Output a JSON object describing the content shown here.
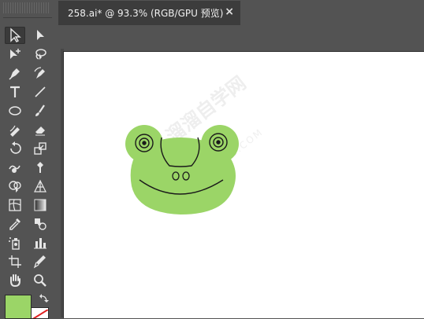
{
  "document_tab": {
    "title": "258.ai* @ 93.3% (RGB/GPU 预览)",
    "close_symbol": "×"
  },
  "tools": [
    {
      "name": "selection-tool-icon",
      "active": true
    },
    {
      "name": "direct-selection-tool-icon"
    },
    {
      "name": "magic-wand-tool-icon"
    },
    {
      "name": "lasso-tool-icon"
    },
    {
      "name": "pen-tool-icon"
    },
    {
      "name": "curvature-tool-icon"
    },
    {
      "name": "type-tool-icon",
      "glyph": "T"
    },
    {
      "name": "line-segment-tool-icon"
    },
    {
      "name": "ellipse-tool-icon"
    },
    {
      "name": "paintbrush-tool-icon"
    },
    {
      "name": "shaper-tool-icon"
    },
    {
      "name": "eraser-tool-icon"
    },
    {
      "name": "rotate-tool-icon"
    },
    {
      "name": "scale-tool-icon"
    },
    {
      "name": "warp-tool-icon"
    },
    {
      "name": "puppet-warp-tool-icon"
    },
    {
      "name": "shape-builder-tool-icon"
    },
    {
      "name": "perspective-grid-tool-icon"
    },
    {
      "name": "mesh-tool-icon"
    },
    {
      "name": "gradient-tool-icon"
    },
    {
      "name": "eyedropper-tool-icon"
    },
    {
      "name": "blend-tool-icon"
    },
    {
      "name": "symbol-sprayer-tool-icon"
    },
    {
      "name": "column-graph-tool-icon"
    },
    {
      "name": "artboard-tool-icon"
    },
    {
      "name": "slice-tool-icon"
    },
    {
      "name": "hand-tool-icon"
    },
    {
      "name": "zoom-tool-icon"
    }
  ],
  "colors": {
    "fill": "#9bd567",
    "stroke": "none",
    "ui_dark": "#535353",
    "tab_bg": "#3c3c3c",
    "frog_green": "#9bd567",
    "frog_line": "#1a1a1a"
  },
  "artboard": {
    "watermark_text": "溜溜自学网",
    "watermark_url": "ZIXUE.3D66.COM"
  }
}
